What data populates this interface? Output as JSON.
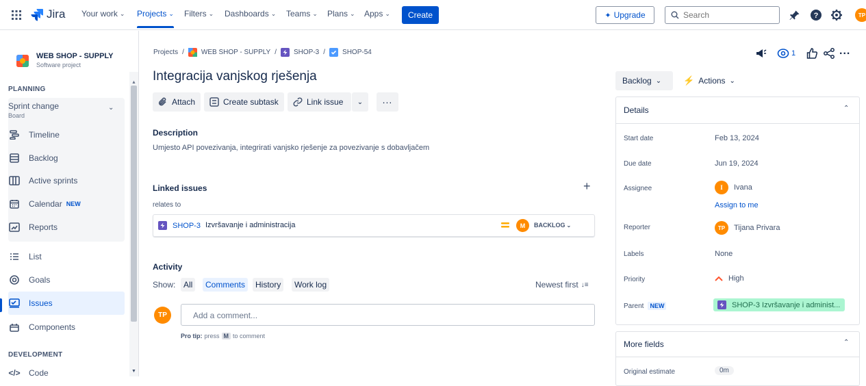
{
  "topnav": {
    "product": "Jira",
    "items": [
      {
        "label": "Your work"
      },
      {
        "label": "Projects"
      },
      {
        "label": "Filters"
      },
      {
        "label": "Dashboards"
      },
      {
        "label": "Teams"
      },
      {
        "label": "Plans"
      },
      {
        "label": "Apps"
      }
    ],
    "create_label": "Create",
    "upgrade_label": "Upgrade",
    "search_placeholder": "Search",
    "user_initials": "TP"
  },
  "sidebar": {
    "project_name": "WEB SHOP - SUPPLY",
    "project_type": "Software project",
    "planning_label": "PLANNING",
    "board_name": "Sprint change",
    "board_sub": "Board",
    "board_items": [
      {
        "label": "Timeline",
        "icon": "timeline-icon"
      },
      {
        "label": "Backlog",
        "icon": "backlog-icon"
      },
      {
        "label": "Active sprints",
        "icon": "board-icon"
      },
      {
        "label": "Calendar",
        "badge": "NEW",
        "icon": "calendar-icon"
      },
      {
        "label": "Reports",
        "icon": "reports-icon"
      }
    ],
    "items": [
      {
        "label": "List",
        "icon": "list-icon"
      },
      {
        "label": "Goals",
        "icon": "goals-icon"
      },
      {
        "label": "Issues",
        "icon": "issues-icon"
      },
      {
        "label": "Components",
        "icon": "components-icon"
      }
    ],
    "development_label": "DEVELOPMENT",
    "code_label": "Code"
  },
  "breadcrumb": {
    "projects": "Projects",
    "project": "WEB SHOP - SUPPLY",
    "parent": "SHOP-3",
    "issue": "SHOP-54"
  },
  "issue": {
    "title": "Integracija vanjskog rješenja",
    "toolbar": {
      "attach": "Attach",
      "create_subtask": "Create subtask",
      "link_issue": "Link issue"
    },
    "description_label": "Description",
    "description": "Umjesto API povezivanja, integrirati vanjsko rješenje za povezivanje s dobavljačem",
    "linked_label": "Linked issues",
    "relates_to": "relates to",
    "linked": {
      "key": "SHOP-3",
      "summary": "Izvršavanje i administracija",
      "assignee_initial": "M",
      "status": "BACKLOG"
    },
    "activity": {
      "label": "Activity",
      "show_label": "Show:",
      "filters": [
        "All",
        "Comments",
        "History",
        "Work log"
      ],
      "active_filter": "Comments",
      "sort": "Newest first",
      "comment_placeholder": "Add a comment...",
      "avatar": "TP",
      "pro_tip_prefix": "Pro tip:",
      "pro_tip_press": "press",
      "pro_tip_key": "M",
      "pro_tip_suffix": "to comment"
    }
  },
  "details": {
    "status_label": "Backlog",
    "actions_label": "Actions",
    "watch_count": "1",
    "header": "Details",
    "rows": {
      "start_date_label": "Start date",
      "start_date": "Feb 13, 2024",
      "due_date_label": "Due date",
      "due_date": "Jun 19, 2024",
      "assignee_label": "Assignee",
      "assignee": "Ivana",
      "assignee_initial": "I",
      "assign_to_me": "Assign to me",
      "reporter_label": "Reporter",
      "reporter": "Tijana Privara",
      "reporter_initials": "TP",
      "labels_label": "Labels",
      "labels": "None",
      "priority_label": "Priority",
      "priority": "High",
      "parent_label": "Parent",
      "parent_badge": "NEW",
      "parent": "SHOP-3 Izvršavanje i administ..."
    },
    "more_fields": "More fields",
    "original_estimate_label": "Original estimate",
    "original_estimate": "0m"
  },
  "colors": {
    "accent": "#0052cc",
    "avatar_orange": "#ff8b00",
    "epic_purple": "#6554c0",
    "story_blue": "#4c9aff",
    "parent_bg": "#abf5d1"
  }
}
